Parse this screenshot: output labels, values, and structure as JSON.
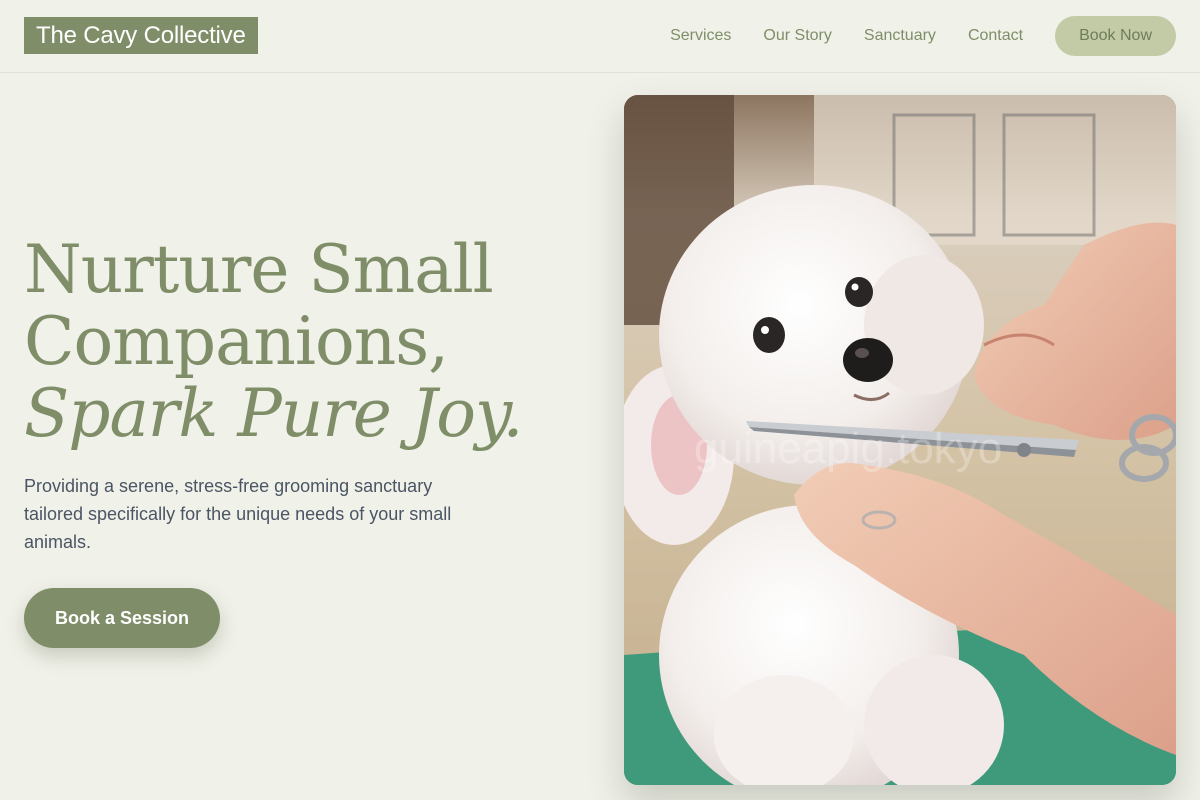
{
  "brand": {
    "logo_text": "The Cavy Collective"
  },
  "nav": {
    "items": [
      {
        "label": "Services"
      },
      {
        "label": "Our Story"
      },
      {
        "label": "Sanctuary"
      },
      {
        "label": "Contact"
      }
    ],
    "cta_label": "Book Now"
  },
  "hero": {
    "title_line1": "Nurture Small",
    "title_line2": "Companions,",
    "title_line3": "Spark Pure Joy.",
    "description": "Providing a serene, stress-free grooming sanctuary tailored specifically for the unique needs of your small animals.",
    "cta_label": "Book a Session",
    "image_watermark": "guineapig.tokyo"
  },
  "colors": {
    "accent": "#7f8e68",
    "accent_light": "#c2cba6",
    "background": "#f0f1e9",
    "body_text": "#4b5563"
  }
}
